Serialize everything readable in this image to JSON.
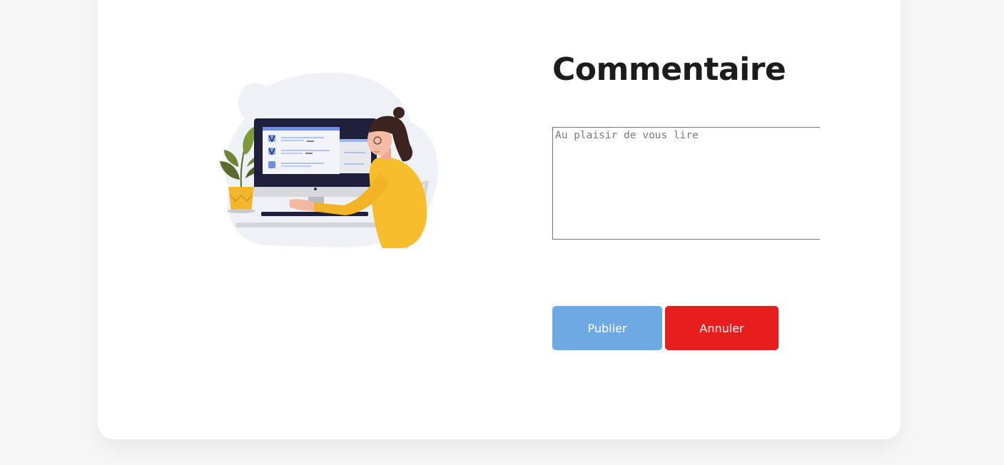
{
  "form": {
    "title": "Commentaire",
    "comment_placeholder": "Au plaisir de vous lire",
    "comment_value": "",
    "publish_label": "Publier",
    "cancel_label": "Annuler"
  },
  "illustration": {
    "icon": "woman-at-computer-illustration"
  },
  "colors": {
    "background": "#f7f7f7",
    "card": "#ffffff",
    "publish_button": "#6daae4",
    "cancel_button": "#e81e1e",
    "title": "#1c1c1c"
  }
}
